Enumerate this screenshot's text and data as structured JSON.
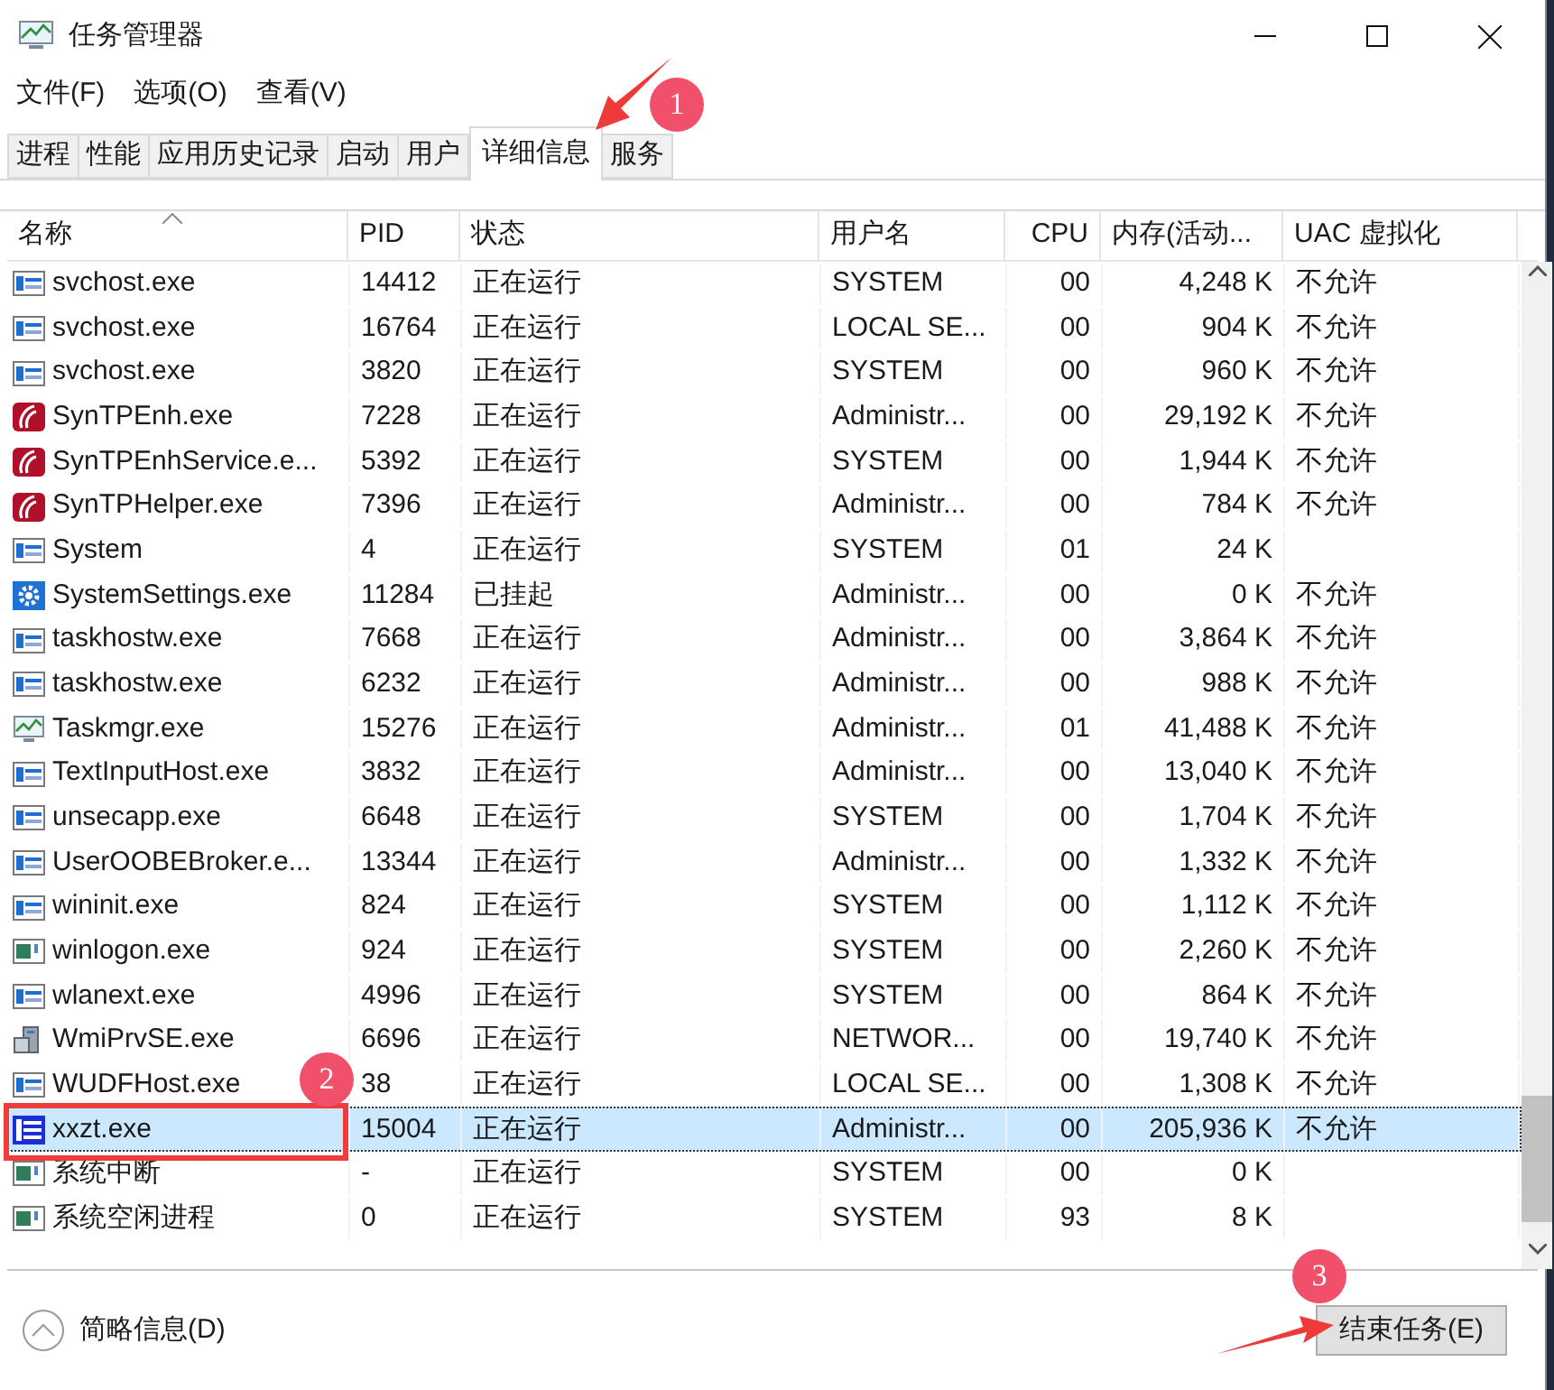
{
  "window": {
    "title": "任务管理器"
  },
  "menu": [
    "文件(F)",
    "选项(O)",
    "查看(V)"
  ],
  "tabs": [
    {
      "label": "进程",
      "selected": false
    },
    {
      "label": "性能",
      "selected": false
    },
    {
      "label": "应用历史记录",
      "selected": false
    },
    {
      "label": "启动",
      "selected": false
    },
    {
      "label": "用户",
      "selected": false
    },
    {
      "label": "详细信息",
      "selected": true
    },
    {
      "label": "服务",
      "selected": false
    }
  ],
  "table": {
    "columns": [
      "名称",
      "PID",
      "状态",
      "用户名",
      "CPU",
      "内存(活动...",
      "UAC 虚拟化"
    ],
    "rows": [
      {
        "kind": "window",
        "name": "svchost.exe",
        "pid": "14412",
        "status": "正在运行",
        "user": "SYSTEM",
        "cpu": "00",
        "memory": "4,248 K",
        "uac": "不允许",
        "selected": false
      },
      {
        "kind": "window",
        "name": "svchost.exe",
        "pid": "16764",
        "status": "正在运行",
        "user": "LOCAL SE...",
        "cpu": "00",
        "memory": "904 K",
        "uac": "不允许",
        "selected": false
      },
      {
        "kind": "window",
        "name": "svchost.exe",
        "pid": "3820",
        "status": "正在运行",
        "user": "SYSTEM",
        "cpu": "00",
        "memory": "960 K",
        "uac": "不允许",
        "selected": false
      },
      {
        "kind": "touchpad",
        "name": "SynTPEnh.exe",
        "pid": "7228",
        "status": "正在运行",
        "user": "Administr...",
        "cpu": "00",
        "memory": "29,192 K",
        "uac": "不允许",
        "selected": false
      },
      {
        "kind": "touchpad",
        "name": "SynTPEnhService.e...",
        "pid": "5392",
        "status": "正在运行",
        "user": "SYSTEM",
        "cpu": "00",
        "memory": "1,944 K",
        "uac": "不允许",
        "selected": false
      },
      {
        "kind": "touchpad",
        "name": "SynTPHelper.exe",
        "pid": "7396",
        "status": "正在运行",
        "user": "Administr...",
        "cpu": "00",
        "memory": "784 K",
        "uac": "不允许",
        "selected": false
      },
      {
        "kind": "window",
        "name": "System",
        "pid": "4",
        "status": "正在运行",
        "user": "SYSTEM",
        "cpu": "01",
        "memory": "24 K",
        "selected": false
      },
      {
        "kind": "gear",
        "name": "SystemSettings.exe",
        "pid": "11284",
        "status": "已挂起",
        "user": "Administr...",
        "cpu": "00",
        "memory": "0 K",
        "uac": "不允许",
        "selected": false
      },
      {
        "kind": "window",
        "name": "taskhostw.exe",
        "pid": "7668",
        "status": "正在运行",
        "user": "Administr...",
        "cpu": "00",
        "memory": "3,864 K",
        "uac": "不允许",
        "selected": false
      },
      {
        "kind": "window",
        "name": "taskhostw.exe",
        "pid": "6232",
        "status": "正在运行",
        "user": "Administr...",
        "cpu": "00",
        "memory": "988 K",
        "uac": "不允许",
        "selected": false
      },
      {
        "kind": "monitor",
        "name": "Taskmgr.exe",
        "pid": "15276",
        "status": "正在运行",
        "user": "Administr...",
        "cpu": "01",
        "memory": "41,488 K",
        "uac": "不允许",
        "selected": false
      },
      {
        "kind": "window",
        "name": "TextInputHost.exe",
        "pid": "3832",
        "status": "正在运行",
        "user": "Administr...",
        "cpu": "00",
        "memory": "13,040 K",
        "uac": "不允许",
        "selected": false
      },
      {
        "kind": "window",
        "name": "unsecapp.exe",
        "pid": "6648",
        "status": "正在运行",
        "user": "SYSTEM",
        "cpu": "00",
        "memory": "1,704 K",
        "uac": "不允许",
        "selected": false
      },
      {
        "kind": "window",
        "name": "UserOOBEBroker.e...",
        "pid": "13344",
        "status": "正在运行",
        "user": "Administr...",
        "cpu": "00",
        "memory": "1,332 K",
        "uac": "不允许",
        "selected": false
      },
      {
        "kind": "window",
        "name": "wininit.exe",
        "pid": "824",
        "status": "正在运行",
        "user": "SYSTEM",
        "cpu": "00",
        "memory": "1,112 K",
        "uac": "不允许",
        "selected": false
      },
      {
        "kind": "green-window",
        "name": "winlogon.exe",
        "pid": "924",
        "status": "正在运行",
        "user": "SYSTEM",
        "cpu": "00",
        "memory": "2,260 K",
        "uac": "不允许",
        "selected": false
      },
      {
        "kind": "window",
        "name": "wlanext.exe",
        "pid": "4996",
        "status": "正在运行",
        "user": "SYSTEM",
        "cpu": "00",
        "memory": "864 K",
        "uac": "不允许",
        "selected": false
      },
      {
        "kind": "server",
        "name": "WmiPrvSE.exe",
        "pid": "6696",
        "status": "正在运行",
        "user": "NETWOR...",
        "cpu": "00",
        "memory": "19,740 K",
        "uac": "不允许",
        "selected": false
      },
      {
        "kind": "window",
        "name": "WUDFHost.exe",
        "pid": "38",
        "status": "正在运行",
        "user": "LOCAL SE...",
        "cpu": "00",
        "memory": "1,308 K",
        "uac": "不允许",
        "selected": false
      },
      {
        "kind": "document",
        "name": "xxzt.exe",
        "pid": "15004",
        "status": "正在运行",
        "user": "Administr...",
        "cpu": "00",
        "memory": "205,936 K",
        "uac": "不允许",
        "selected": true
      },
      {
        "kind": "green-window",
        "name": "系统中断",
        "pid": "-",
        "status": "正在运行",
        "user": "SYSTEM",
        "cpu": "00",
        "memory": "0 K",
        "selected": false
      },
      {
        "kind": "green-window",
        "name": "系统空闲进程",
        "pid": "0",
        "status": "正在运行",
        "user": "SYSTEM",
        "cpu": "93",
        "memory": "8 K",
        "selected": false
      }
    ]
  },
  "footer": {
    "details_toggle": "简略信息(D)",
    "end_task_button": "结束任务(E)"
  },
  "annotations": [
    {
      "label": "1",
      "kind": "tab"
    },
    {
      "label": "2",
      "kind": "row"
    },
    {
      "label": "3",
      "kind": "button"
    }
  ]
}
